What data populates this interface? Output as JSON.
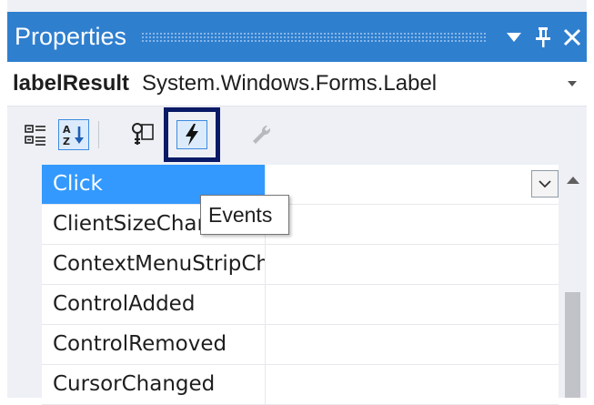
{
  "window": {
    "title": "Properties",
    "buttons": {
      "dropdown_icon": "triangle-down",
      "pin_icon": "pushpin",
      "close_icon": "x"
    }
  },
  "object_selector": {
    "name": "labelResult",
    "type": "System.Windows.Forms.Label"
  },
  "toolbar": {
    "buttons": [
      {
        "name": "categorized",
        "icon": "categorized-icon"
      },
      {
        "name": "alphabetical",
        "icon": "alphabetical-icon",
        "active": true
      },
      {
        "name": "properties",
        "icon": "properties-icon"
      },
      {
        "name": "events",
        "icon": "lightning-icon",
        "active": true
      },
      {
        "name": "property-pages",
        "icon": "wrench-icon",
        "disabled": true
      }
    ]
  },
  "tooltip": {
    "text": "Events"
  },
  "events": [
    {
      "name": "Click",
      "value": "",
      "selected": true
    },
    {
      "name": "ClientSizeChanged",
      "value": ""
    },
    {
      "name": "ContextMenuStripChanged",
      "value": ""
    },
    {
      "name": "ControlAdded",
      "value": ""
    },
    {
      "name": "ControlRemoved",
      "value": ""
    },
    {
      "name": "CursorChanged",
      "value": ""
    }
  ],
  "colors": {
    "titlebar": "#2f7fcf",
    "selection": "#3399ff",
    "highlight_box": "#0a1a66",
    "panel_bg": "#eef0f5"
  }
}
